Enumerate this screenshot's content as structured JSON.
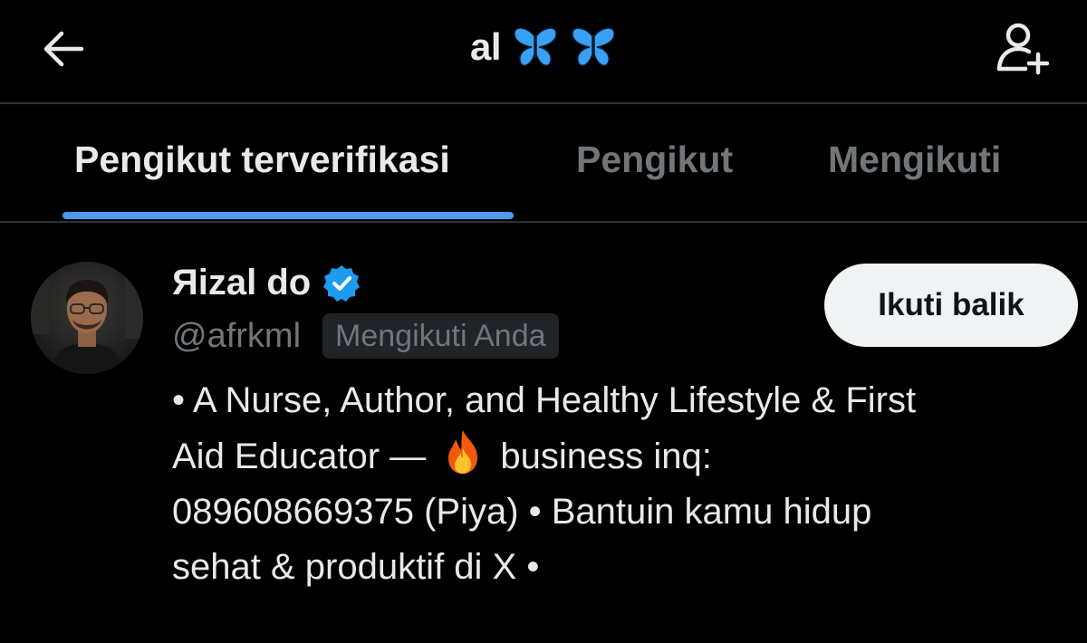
{
  "header": {
    "title": "al",
    "title_emojis": [
      "butterfly-icon",
      "butterfly-icon"
    ],
    "back_icon": "back-arrow-icon",
    "add_user_icon": "add-user-icon"
  },
  "tabs": [
    {
      "label": "Pengikut terverifikasi",
      "active": true
    },
    {
      "label": "Pengikut",
      "active": false
    },
    {
      "label": "Mengikuti",
      "active": false
    }
  ],
  "accent_color": "#4c9bed",
  "user": {
    "display_name": "Яizal do",
    "verified": true,
    "handle": "@afrkml",
    "follows_you_badge": "Mengikuti Anda",
    "follow_button_label": "Ikuti balik",
    "bio_part1": "• A Nurse, Author, and Healthy Lifestyle & First\nAid Educator — ",
    "bio_emoji": "fire-icon",
    "bio_part2": " business inq:\n089608669375 (Piya) • Bantuin kamu hidup\nsehat & produktif di X •"
  }
}
